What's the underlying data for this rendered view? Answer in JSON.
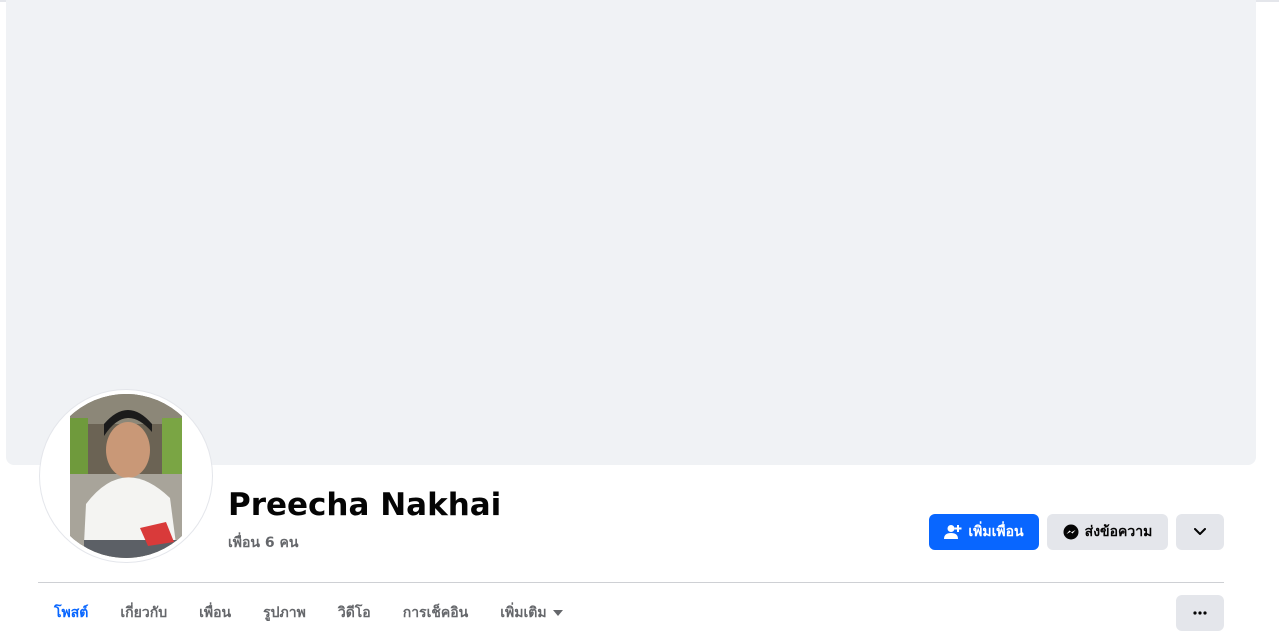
{
  "profile": {
    "name": "Preecha Nakhai",
    "friends_count": "เพื่อน 6 คน"
  },
  "actions": {
    "add_friend_label": "เพิ่มเพื่อน",
    "message_label": "ส่งข้อความ"
  },
  "tabs": [
    {
      "label": "โพสต์",
      "active": true
    },
    {
      "label": "เกี่ยวกับ"
    },
    {
      "label": "เพื่อน"
    },
    {
      "label": "รูปภาพ"
    },
    {
      "label": "วิดีโอ"
    },
    {
      "label": "การเช็คอิน"
    },
    {
      "label": "เพิ่มเติม"
    }
  ],
  "icons": {
    "add_friend": "person-plus-icon",
    "message": "messenger-icon",
    "chevron": "chevron-down-icon",
    "more_caret": "caret-down-icon",
    "more": "ellipsis-icon"
  },
  "colors": {
    "accent": "#0866ff",
    "cover": "#f0f2f5",
    "button_secondary": "#e4e6eb",
    "text_primary": "#050505",
    "text_secondary": "#65676b"
  }
}
